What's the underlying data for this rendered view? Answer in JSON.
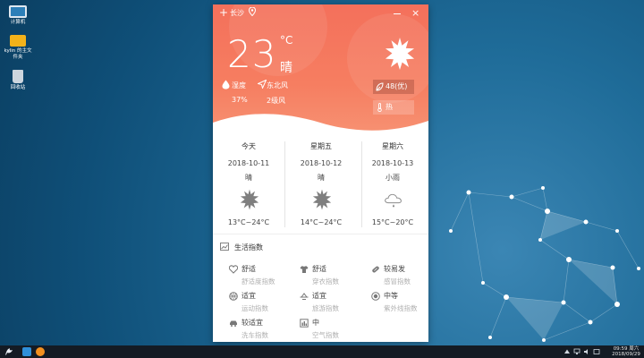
{
  "desktop": {
    "icons": [
      {
        "label": "计算机",
        "icon": "computer-icon"
      },
      {
        "label": "kylin 的主文件夹",
        "icon": "folder-icon"
      },
      {
        "label": "回收站",
        "icon": "trash-icon"
      }
    ]
  },
  "weather": {
    "titlebar": {
      "add": "+",
      "city": "长沙",
      "close": "×"
    },
    "current": {
      "temperature": "23",
      "unit": "°C",
      "condition": "晴",
      "humidity_label": "湿度",
      "humidity_value": "37%",
      "wind_label": "东北风",
      "wind_value": "2级风",
      "aqi": "48(优)",
      "heat": "热"
    },
    "forecast": [
      {
        "day": "今天",
        "date": "2018-10-11",
        "condition": "晴",
        "icon": "sunny-icon",
        "range": "13°C~24°C"
      },
      {
        "day": "星期五",
        "date": "2018-10-12",
        "condition": "晴",
        "icon": "sunny-icon",
        "range": "14°C~24°C"
      },
      {
        "day": "星期六",
        "date": "2018-10-13",
        "condition": "小雨",
        "icon": "rain-cloud-icon",
        "range": "15°C~20°C"
      }
    ],
    "life_index": {
      "title": "生活指数",
      "items": [
        {
          "value": "舒适",
          "name": "舒适度指数",
          "icon": "comfort-icon"
        },
        {
          "value": "舒适",
          "name": "穿衣指数",
          "icon": "clothing-icon"
        },
        {
          "value": "较易发",
          "name": "感冒指数",
          "icon": "cold-icon"
        },
        {
          "value": "适宜",
          "name": "运动指数",
          "icon": "sport-icon"
        },
        {
          "value": "适宜",
          "name": "旅游指数",
          "icon": "travel-icon"
        },
        {
          "value": "中等",
          "name": "紫外线指数",
          "icon": "uv-icon"
        },
        {
          "value": "较适宜",
          "name": "洗车指数",
          "icon": "car-wash-icon"
        },
        {
          "value": "中",
          "name": "空气指数",
          "icon": "air-icon"
        }
      ]
    }
  },
  "taskbar": {
    "time": "09:59 周六",
    "date": "2018/09/29"
  },
  "colors": {
    "hero_top": "#f4705b",
    "hero_bottom": "#f79374",
    "desktop": "#1f6c99",
    "taskbar": "#141b24"
  }
}
